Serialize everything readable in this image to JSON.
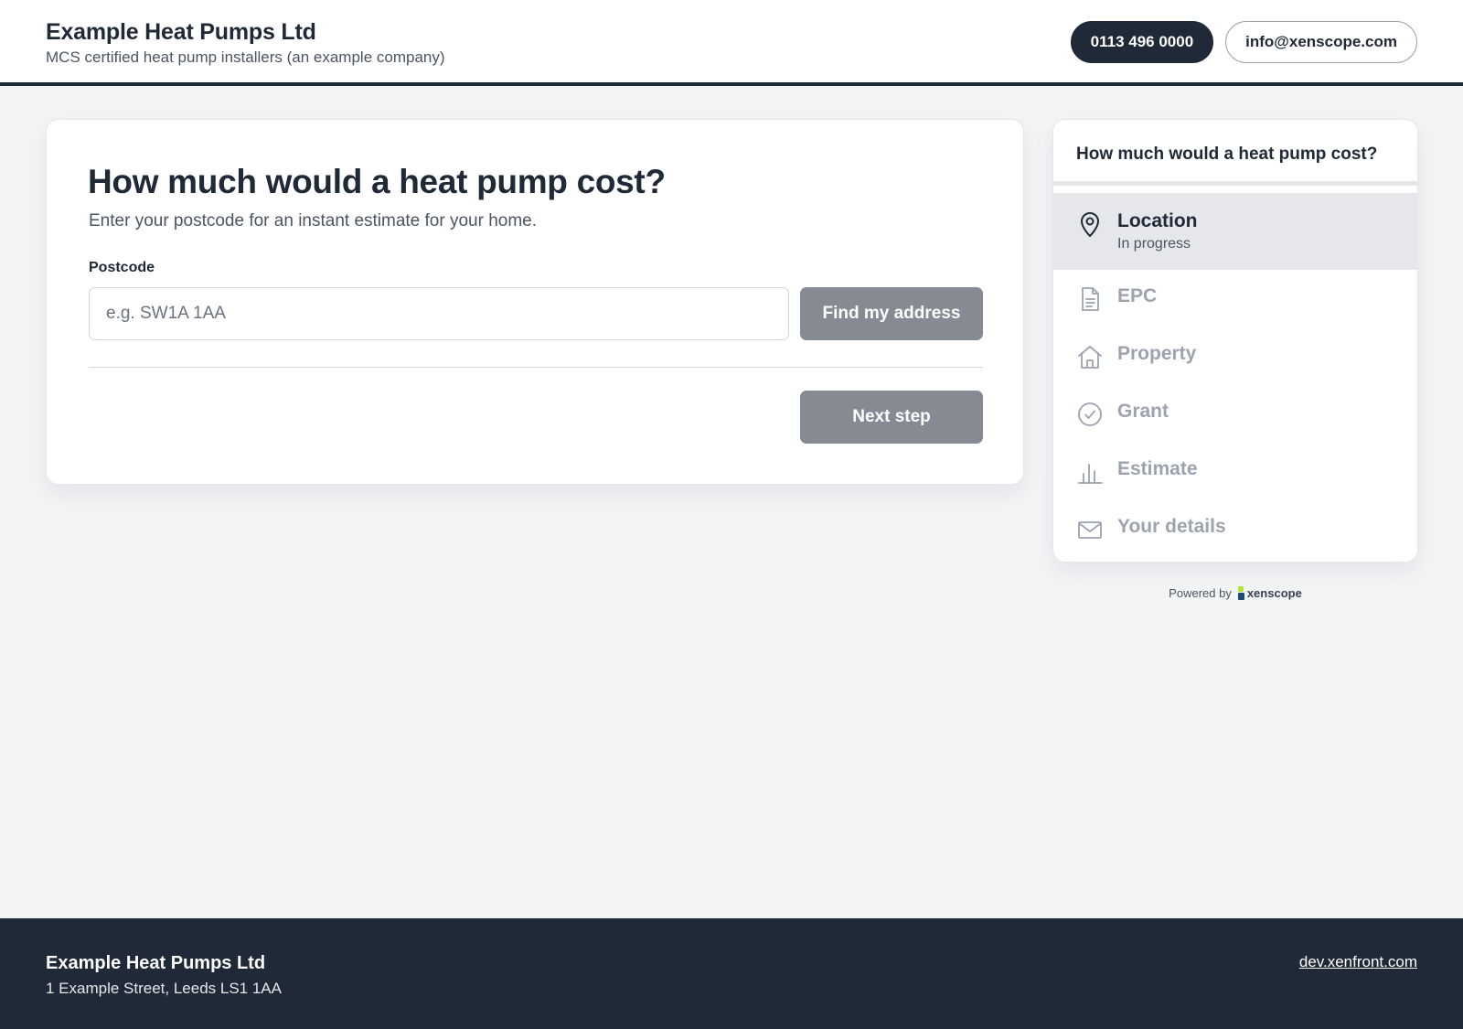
{
  "header": {
    "company_name": "Example Heat Pumps Ltd",
    "tagline": "MCS certified heat pump installers (an example company)",
    "phone": "0113 496 0000",
    "email": "info@xenscope.com"
  },
  "main": {
    "title": "How much would a heat pump cost?",
    "subtitle": "Enter your postcode for an instant estimate for your home.",
    "postcode_label": "Postcode",
    "postcode_value": "",
    "postcode_placeholder": "e.g. SW1A 1AA",
    "find_button": "Find my address",
    "next_button": "Next step"
  },
  "progress": {
    "title": "How much would a heat pump cost?",
    "steps": [
      {
        "label": "Location",
        "status": "In progress",
        "icon": "map-pin-icon",
        "active": true
      },
      {
        "label": "EPC",
        "icon": "document-icon",
        "active": false
      },
      {
        "label": "Property",
        "icon": "house-icon",
        "active": false
      },
      {
        "label": "Grant",
        "icon": "check-circle-icon",
        "active": false
      },
      {
        "label": "Estimate",
        "icon": "bar-chart-icon",
        "active": false
      },
      {
        "label": "Your details",
        "icon": "envelope-icon",
        "active": false
      }
    ]
  },
  "powered_by": {
    "label": "Powered by",
    "brand": "xenscope"
  },
  "footer": {
    "company_name": "Example Heat Pumps Ltd",
    "address": "1 Example Street, Leeds LS1 1AA",
    "link": "dev.xenfront.com"
  },
  "colors": {
    "dark": "#1f2937",
    "page_background": "#f3f4f6",
    "button_disabled": "#868b93",
    "step_inactive": "#9ca3af",
    "logo_green": "#b3e633",
    "logo_blue": "#1f4d7a"
  }
}
